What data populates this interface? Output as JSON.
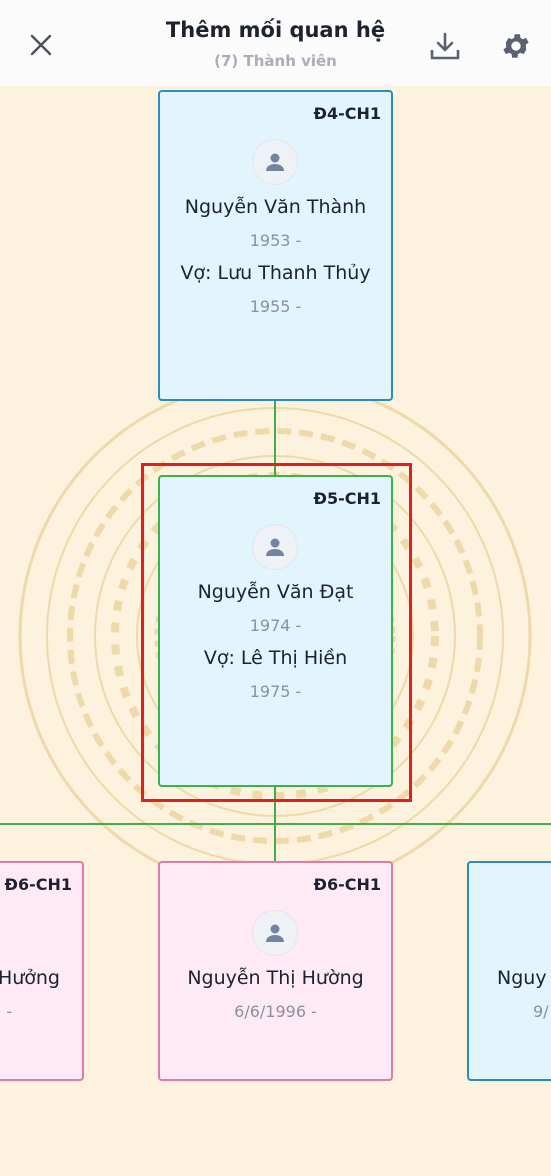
{
  "header": {
    "title": "Thêm mối quan hệ",
    "subtitle": "(7) Thành viên",
    "close_icon": "close-icon",
    "download_icon": "download-icon",
    "settings_icon": "gear-icon"
  },
  "colors": {
    "background": "#fcf2dd",
    "male_card": "#e2f4fc",
    "male_border": "#2a8dbd",
    "female_card": "#fdeaf4",
    "female_border": "#e07aa8",
    "connector": "#43ac46",
    "selection": "#df2020"
  },
  "tree": {
    "parent": {
      "generation": "Đ4-CH1",
      "name": "Nguyễn Văn Thành",
      "year": "1953 -",
      "spouse": "Vợ: Lưu Thanh Thủy",
      "spouse_year": "1955 -"
    },
    "selected": {
      "generation": "Đ5-CH1",
      "name": "Nguyễn Văn Đạt",
      "year": "1974 -",
      "spouse": "Vợ: Lê Thị Hiền",
      "spouse_year": "1975 -"
    },
    "children": [
      {
        "generation": "Đ6-CH1",
        "name": "Hưởng",
        "year": "-"
      },
      {
        "generation": "Đ6-CH1",
        "name": "Nguyễn Thị Hường",
        "year": "6/6/1996 -"
      },
      {
        "generation": "",
        "name": "Nguy",
        "year": "9/"
      }
    ]
  }
}
